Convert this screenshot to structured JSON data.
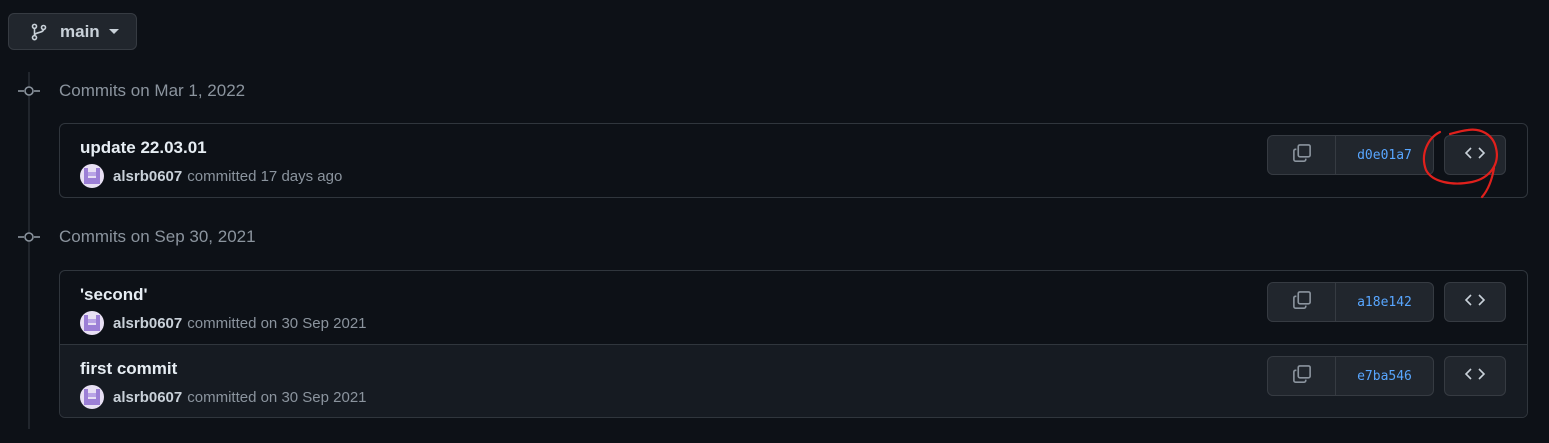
{
  "branch": {
    "label": "main",
    "icon": "git-branch-icon"
  },
  "groups": [
    {
      "title": "Commits on Mar 1, 2022",
      "commits": [
        {
          "message": "update 22.03.01",
          "author": "alsrb0607",
          "time_text": "committed 17 days ago",
          "sha": "d0e01a7"
        }
      ]
    },
    {
      "title": "Commits on Sep 30, 2021",
      "commits": [
        {
          "message": "'second'",
          "author": "alsrb0607",
          "time_text": "committed on 30 Sep 2021",
          "sha": "a18e142"
        },
        {
          "message": "first commit",
          "author": "alsrb0607",
          "time_text": "committed on 30 Sep 2021",
          "sha": "e7ba546"
        }
      ]
    }
  ],
  "icons": {
    "copy": "copy-icon",
    "browse": "code-icon",
    "node": "git-commit-icon",
    "annotation": "red-circle-annotation"
  },
  "colors": {
    "background": "#0d1117",
    "sha_link": "#58a6ff",
    "annotation": "#e0201c"
  }
}
